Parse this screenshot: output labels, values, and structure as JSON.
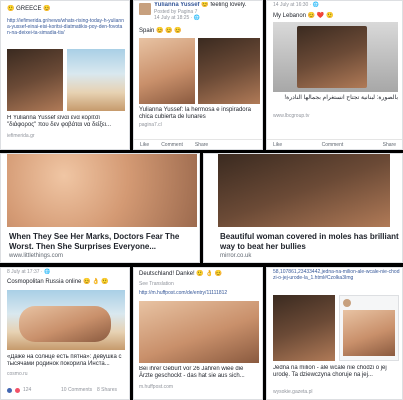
{
  "panels": {
    "p1": {
      "header": "🙂 GREECE 😊",
      "url": "http://iefimerida.gr/news/whats-rising-today-h-yulianna-yussef-einai-eisi-koritsi-diatmatikis-poy-den-fovotan-na-deixei-ta-simadia-tis/",
      "caption": "Η Yulianna Yussef είναι ένα κορίτσι \"διάφορος\" που δεν φοβάται να δείξει...",
      "domain": "iefimerida.gr"
    },
    "p2": {
      "name": "Yulianna Yussef",
      "status": "😊 feeling lovely.",
      "posted": "Posted by Pagina 7",
      "time": "14 July at 18:25 · 🌐",
      "text": "Spain 😊 😊 😊",
      "caption1": "Yulianna Yussef: la hermosa e inspiradora",
      "caption2": "chica cubierta de lunares",
      "domain": "pagina7.cl",
      "like": "Like",
      "comment": "Comment",
      "share": "Share"
    },
    "p3": {
      "time": "14 July at 16:30 · 🌐",
      "text": "My Lebanon 😊 ❤️ 🙂",
      "caption": "بالصورة: لبنانية تجتاح انستغرام بجمالها النادرة!",
      "domain": "www.lbcgroup.tv",
      "like": "Like",
      "comment": "Comment",
      "share": "Share"
    },
    "p4": {
      "title": "When They See Her Marks, Doctors Fear The Worst. Then She Surprises Everyone...",
      "domain": "www.littlethings.com"
    },
    "p5": {
      "title": "Beautiful woman covered in moles has brilliant way to beat her bullies",
      "domain": "mirror.co.uk"
    },
    "p6": {
      "time": "8 July at 17:37 · 🌐",
      "text": "Cosmopolitan Russia online 😊 👌 🙂",
      "caption": "«Даже на солнце есть пятна»: девушка с тысячами родинок покорила Инста...",
      "domain": "cosmo.ru",
      "reactions": "124",
      "comments": "10 Comments",
      "shares": "8 Shares"
    },
    "p7": {
      "text": "Deutschland! Danke! 🙂 👌 😊",
      "translate": "See Translation",
      "url": "http://m.huffpost.com/de/entry/11111812",
      "caption": "Bei ihrer Geburt vor 26 Jahren wiee die Ärzte geschockt - das hat sie aus sich...",
      "domain": "m.huffpost.com"
    },
    "p8": {
      "url": "58,107861,23433442,jedna-na-milion-ale-wcale-nie-chodzi-o-jej-urode-la_1.html#Czolka3Img",
      "caption": "Jedna na milion - ale wcale nie chodzi o jej urodę. Ta dziewczyna choruje na jej...",
      "domain": "wysokie.gazeta.pl"
    }
  }
}
